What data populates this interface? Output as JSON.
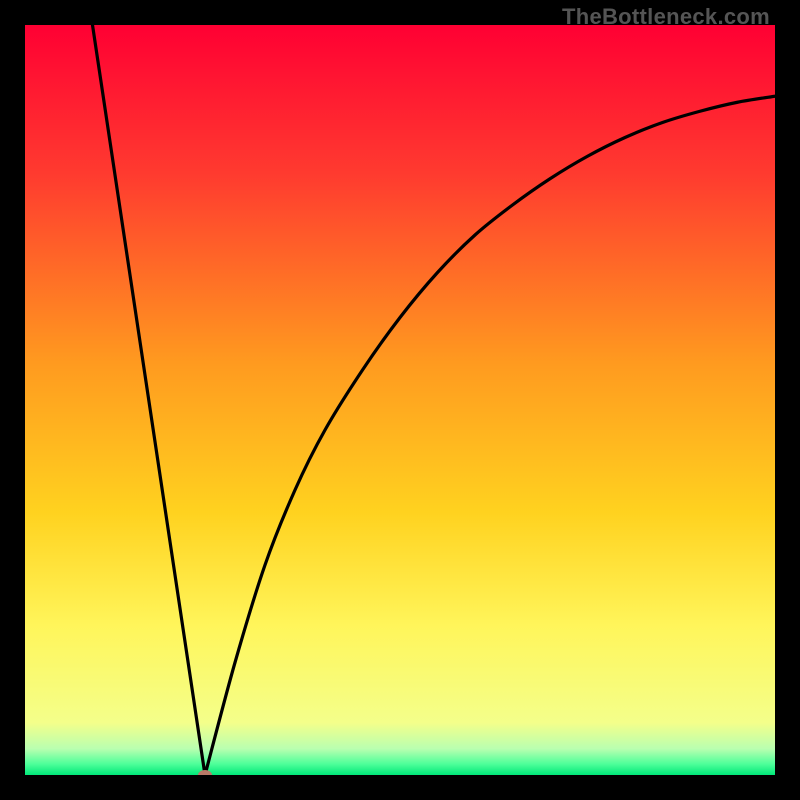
{
  "watermark": "TheBottleneck.com",
  "chart_data": {
    "type": "line",
    "title": "",
    "xlabel": "",
    "ylabel": "",
    "xlim": [
      0,
      100
    ],
    "ylim": [
      0,
      100
    ],
    "grid": false,
    "legend": false,
    "gradient_stops": [
      {
        "offset": 0,
        "color": "#ff0033"
      },
      {
        "offset": 0.2,
        "color": "#ff3b2f"
      },
      {
        "offset": 0.45,
        "color": "#ff9a1f"
      },
      {
        "offset": 0.65,
        "color": "#ffd21f"
      },
      {
        "offset": 0.8,
        "color": "#fff55a"
      },
      {
        "offset": 0.93,
        "color": "#f4ff8a"
      },
      {
        "offset": 0.965,
        "color": "#b9ffb0"
      },
      {
        "offset": 0.985,
        "color": "#4fff9a"
      },
      {
        "offset": 1.0,
        "color": "#00e879"
      }
    ],
    "min_point": {
      "x": 24,
      "y": 0
    },
    "marker": {
      "x": 24,
      "y": 0,
      "color": "#b97a68",
      "rx": 7,
      "ry": 5
    },
    "left_branch": {
      "comment": "steep descending line from top-left to the minimum",
      "x": [
        9,
        24
      ],
      "y": [
        100,
        0
      ]
    },
    "right_branch": {
      "comment": "concave rising curve from minimum toward upper right, flattening",
      "x": [
        24,
        28,
        32,
        36,
        40,
        45,
        50,
        55,
        60,
        65,
        70,
        75,
        80,
        85,
        90,
        95,
        100
      ],
      "y": [
        0,
        15,
        28,
        38,
        46,
        54,
        61,
        67,
        72,
        76,
        79.5,
        82.5,
        85,
        87,
        88.5,
        89.7,
        90.5
      ]
    }
  }
}
